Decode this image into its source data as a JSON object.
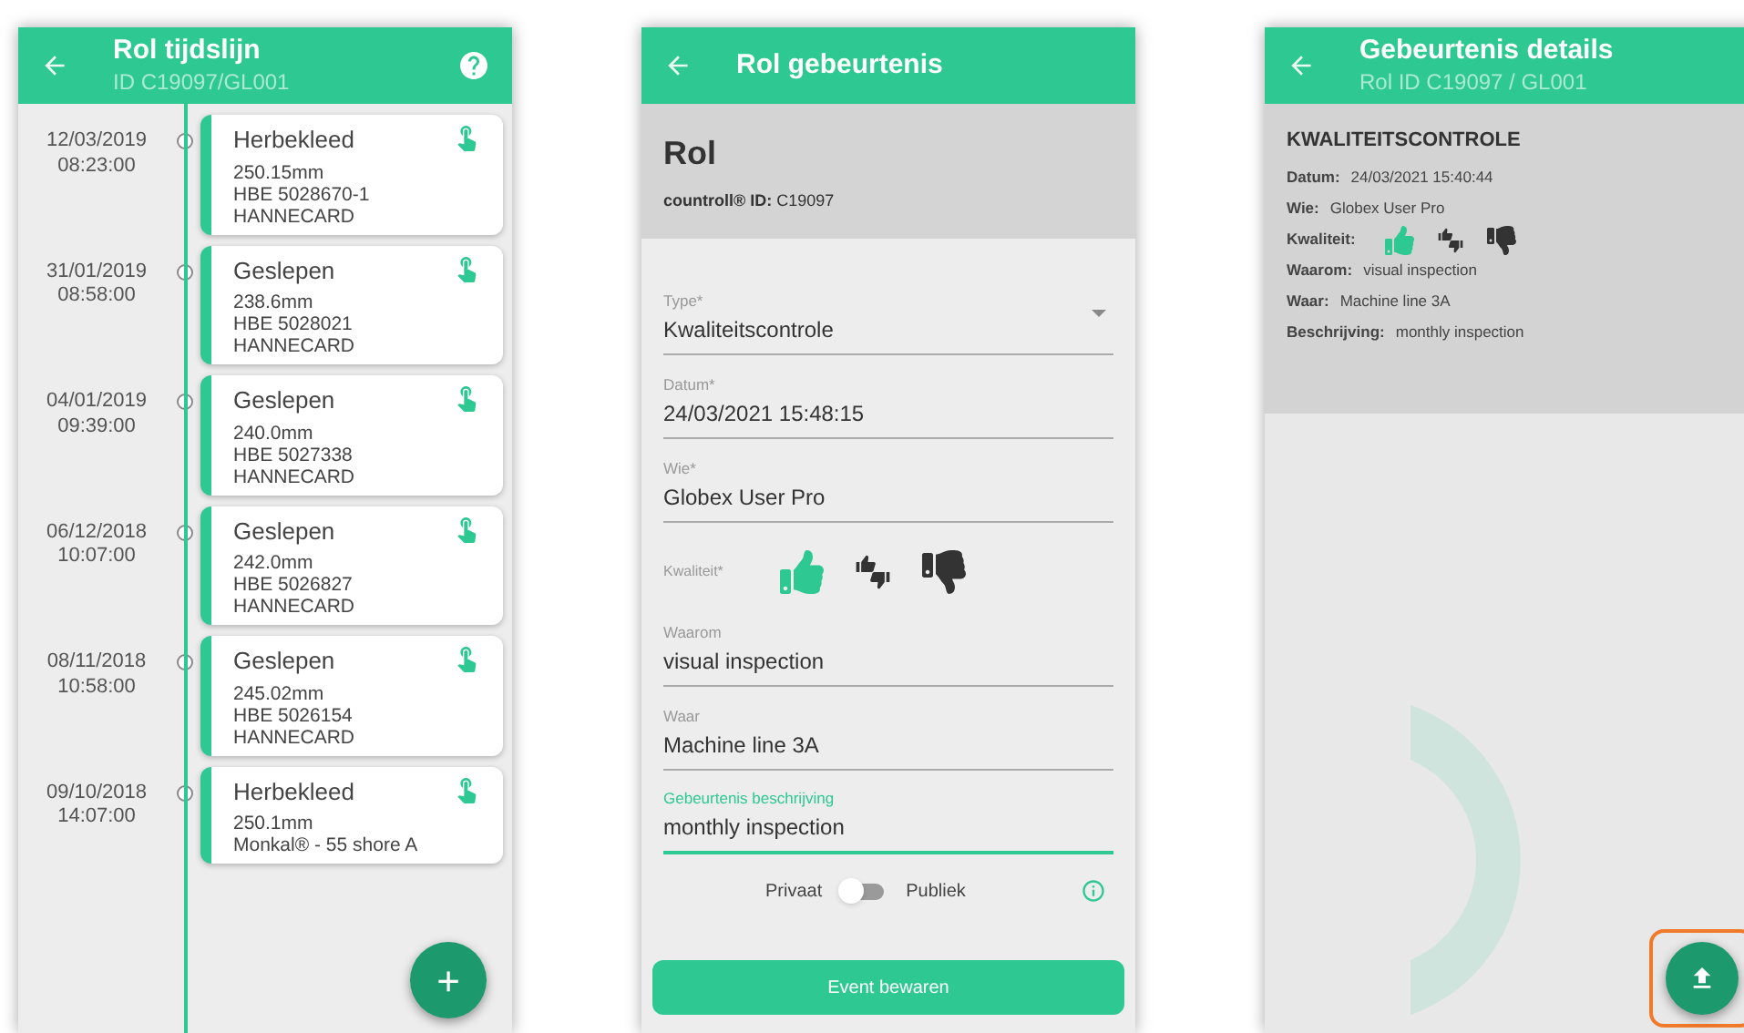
{
  "timeline_screen": {
    "title": "Rol tijdslijn",
    "subtitle": "ID C19097/GL001",
    "events": [
      {
        "date": "12/03/2019",
        "time": "08:23:00",
        "title": "Herbekleed",
        "lines": [
          "250.15mm",
          "HBE 5028670-1",
          "HANNECARD"
        ]
      },
      {
        "date": "31/01/2019",
        "time": "08:58:00",
        "title": "Geslepen",
        "lines": [
          "238.6mm",
          "HBE 5028021",
          "HANNECARD"
        ]
      },
      {
        "date": "04/01/2019",
        "time": "09:39:00",
        "title": "Geslepen",
        "lines": [
          "240.0mm",
          "HBE 5027338",
          "HANNECARD"
        ]
      },
      {
        "date": "06/12/2018",
        "time": "10:07:00",
        "title": "Geslepen",
        "lines": [
          "242.0mm",
          "HBE 5026827",
          "HANNECARD"
        ]
      },
      {
        "date": "08/11/2018",
        "time": "10:58:00",
        "title": "Geslepen",
        "lines": [
          "245.02mm",
          "HBE 5026154",
          "HANNECARD"
        ]
      },
      {
        "date": "09/10/2018",
        "time": "14:07:00",
        "title": "Herbekleed",
        "lines": [
          "250.1mm",
          "Monkal® - 55 shore A"
        ]
      }
    ],
    "add_button": {
      "label": "+"
    }
  },
  "event_screen": {
    "title": "Rol gebeurtenis",
    "heading": "Rol",
    "id_line": "**countroll® ID:** C19097",
    "fields": [
      {
        "kind": "select",
        "label": "Type*",
        "value": "Kwaliteitscontrole",
        "focused": false
      },
      {
        "kind": "text",
        "label": "Datum*",
        "value": "24/03/2021 15:48:15",
        "focused": false
      },
      {
        "kind": "text",
        "label": "Wie*",
        "value": "Globex User Pro",
        "focused": false
      },
      {
        "kind": "quality",
        "label": "Kwaliteit*",
        "options": [
          {
            "kind": "up",
            "selected": true
          },
          {
            "kind": "mixed",
            "selected": false
          },
          {
            "kind": "down",
            "selected": false
          }
        ]
      },
      {
        "kind": "text",
        "label": "Waarom",
        "value": "visual inspection",
        "focused": false
      },
      {
        "kind": "text",
        "label": "Waar",
        "value": "Machine line 3A",
        "focused": false
      },
      {
        "kind": "text",
        "label": "Gebeurtenis beschrijving",
        "value": "monthly inspection",
        "focused": true
      }
    ],
    "visibility": {
      "private_label": "Privaat",
      "public_label": "Publiek",
      "public": false
    },
    "save_button": "Event bewaren"
  },
  "details_screen": {
    "title": "Gebeurtenis details",
    "subtitle": "Rol ID C19097 / GL001",
    "heading": "KWALITEITSCONTROLE",
    "rows": [
      {
        "kind": "text",
        "label": "Datum:",
        "value": "24/03/2021 15:40:44"
      },
      {
        "kind": "text",
        "label": "Wie:",
        "value": "Globex User Pro"
      },
      {
        "kind": "quality",
        "label": "Kwaliteit:",
        "options": [
          {
            "kind": "up",
            "selected": true
          },
          {
            "kind": "mixed",
            "selected": false
          },
          {
            "kind": "down",
            "selected": false
          }
        ]
      },
      {
        "kind": "text",
        "label": "Waarom:",
        "value": "visual inspection"
      },
      {
        "kind": "text",
        "label": "Waar:",
        "value": "Machine line 3A"
      },
      {
        "kind": "text",
        "label": "Beschrijving:",
        "value": "monthly inspection"
      }
    ],
    "upload_button": {
      "highlighted": true
    }
  }
}
